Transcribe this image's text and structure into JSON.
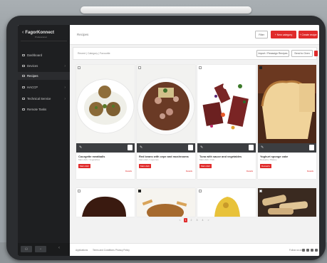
{
  "app": {
    "logo": "FagorKonnect",
    "logo_sub": "Professional",
    "page_title": "Recipes"
  },
  "sidebar": {
    "items": [
      {
        "label": "Dashboard",
        "expandable": false
      },
      {
        "label": "Devices",
        "expandable": true
      },
      {
        "label": "Recipes",
        "expandable": false,
        "active": true
      },
      {
        "label": "HACCP",
        "expandable": true
      },
      {
        "label": "Technical Service",
        "expandable": true
      },
      {
        "label": "Remote Tasks",
        "expandable": false
      }
    ]
  },
  "header": {
    "filter_button": "Filter",
    "new_category_button": "+ New category",
    "create_recipe_button": "+ Create recipe"
  },
  "toolbar": {
    "filter_label": "Recent | Category | Favourite",
    "import_button": "Import / Reassign Recipes",
    "send_button": "Send to Oven"
  },
  "cards": [
    {
      "name": "Courgette meatballs",
      "sub": "Main dish / Vegetables",
      "tag": "Main dish",
      "details": "Details",
      "checked": false
    },
    {
      "name": "Red beans with cepe and mushrooms",
      "sub": "Main dish / Legumes",
      "tag": "Main dish",
      "details": "Details",
      "checked": false
    },
    {
      "name": "Tuna with sauce and vegetables",
      "sub": "Main dish / Fish",
      "tag": "Main dish",
      "details": "Details",
      "checked": false
    },
    {
      "name": "Yoghurt sponge cake",
      "sub": "Desserts / Bakery",
      "tag": "Desserts",
      "details": "Details",
      "checked": true
    },
    {
      "checked": false
    },
    {
      "checked": true
    },
    {
      "checked": false
    },
    {
      "checked": false
    }
  ],
  "pagination": {
    "pages": [
      "<",
      "1",
      "2",
      "3",
      "4",
      ">"
    ],
    "current": "1"
  },
  "footer": {
    "links": [
      "Applications",
      "Terms and Conditions",
      "Privacy Policy"
    ],
    "right_text": "Follow us on"
  },
  "colors": {
    "accent": "#e02b2b",
    "sidebar": "#1e1f21"
  }
}
